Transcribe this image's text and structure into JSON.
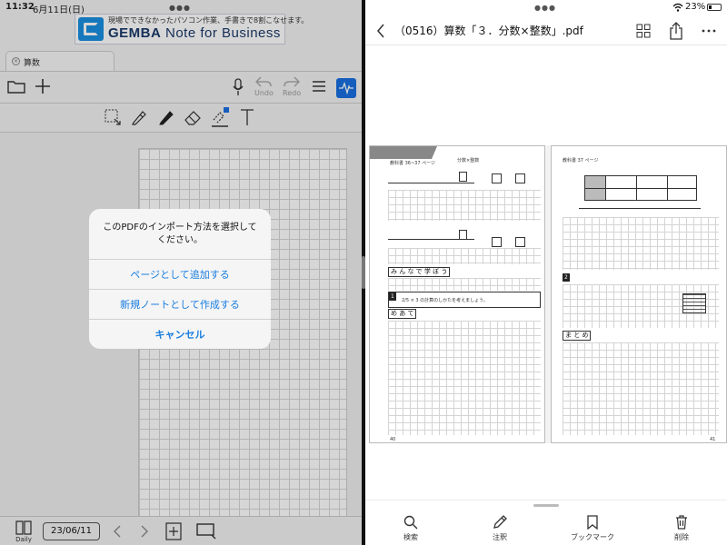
{
  "status": {
    "time": "11:32",
    "date": "6月11日(日)",
    "battery": "23%"
  },
  "banner": {
    "tagline": "現場でできなかったパソコン作業、手書きで8割こなせます。",
    "brand_bold": "GEMBA",
    "brand_rest": " Note for Business"
  },
  "left": {
    "tab_label": "算数",
    "undo_label": "Undo",
    "redo_label": "Redo",
    "date_value": "23/06/11",
    "daily_label": "Daily"
  },
  "dialog": {
    "message": "このPDFのインポート方法を選択してください。",
    "options": [
      "ページとして追加する",
      "新規ノートとして作成する"
    ],
    "cancel": "キャンセル"
  },
  "right": {
    "title": "（0516）算数「３．分数×整数」.pdf",
    "bottom": {
      "search": "検索",
      "annotate": "注釈",
      "bookmark": "ブックマーク",
      "delete": "削除"
    }
  },
  "pdf": {
    "left_page": {
      "header": "教科書 36~37 ページ",
      "subject": "分数×整数",
      "minna": "み ん な で 学 ぼ う",
      "problem_num": "1",
      "problem_text": "2/5 × 3 の計算のしかたを考えましょう。",
      "meate": "め あ て",
      "page_no": "40"
    },
    "right_page": {
      "header": "教科書 37 ページ",
      "problem_num": "2",
      "matome": "ま と め",
      "page_no": "41"
    }
  }
}
